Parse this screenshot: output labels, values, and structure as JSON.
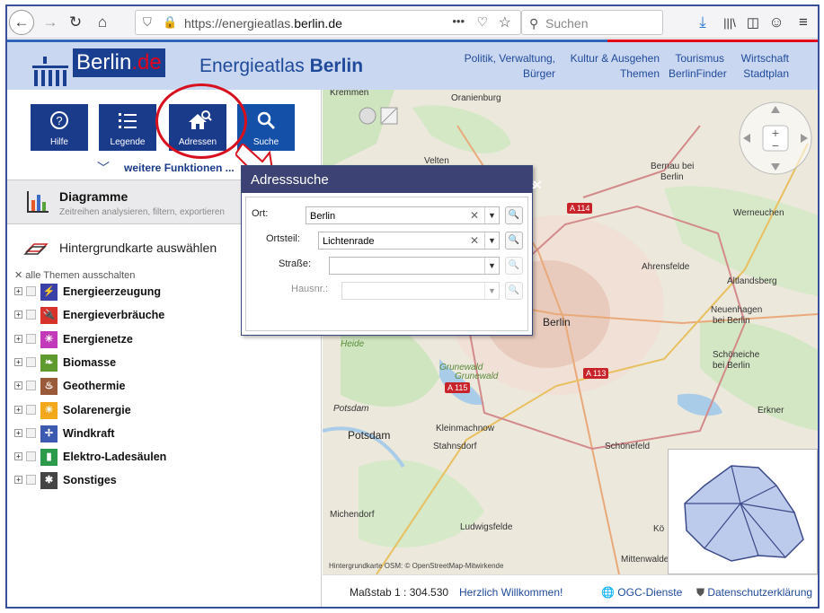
{
  "browser": {
    "url_prefix": "https://energieatlas.",
    "url_domain": "berlin.de",
    "search_placeholder": "Suchen",
    "more_icon": "•••"
  },
  "header": {
    "logo_text": "Berlin",
    "logo_suffix": ".de",
    "app_title_prefix": "Energieatlas ",
    "app_title_bold": "Berlin",
    "nav": [
      {
        "top": "Politik, Verwaltung, Bürger",
        "bottom": ""
      },
      {
        "top": "Kultur & Ausgehen",
        "bottom": "Themen"
      },
      {
        "top": "Tourismus",
        "bottom": "BerlinFinder"
      },
      {
        "top": "Wirtschaft",
        "bottom": "Stadtplan"
      }
    ]
  },
  "toolbar": {
    "buttons": [
      {
        "label": "Hilfe",
        "icon": "help-icon"
      },
      {
        "label": "Legende",
        "icon": "legend-list-icon"
      },
      {
        "label": "Adressen",
        "icon": "address-house-icon"
      },
      {
        "label": "Suche",
        "icon": "search-icon"
      }
    ],
    "more_label": "weitere Funktionen ..."
  },
  "diagramme": {
    "title": "Diagramme",
    "subtitle": "Zeitreihen analysieren, filtern, exportieren"
  },
  "background_map_label": "Hintergrundkarte auswählen",
  "all_off_label": "alle Themen ausschalten",
  "layers": [
    {
      "name": "Energieerzeugung",
      "color": "#3b3fa8",
      "icon": "⚡"
    },
    {
      "name": "Energieverbräuche",
      "color": "#d7332a",
      "icon": "🔌"
    },
    {
      "name": "Energienetze",
      "color": "#c23ab9",
      "icon": "✳"
    },
    {
      "name": "Biomasse",
      "color": "#5f9a2f",
      "icon": "❧"
    },
    {
      "name": "Geothermie",
      "color": "#9a5a3a",
      "icon": "♨"
    },
    {
      "name": "Solarenergie",
      "color": "#f3a81c",
      "icon": "☀"
    },
    {
      "name": "Windkraft",
      "color": "#3b5ab0",
      "icon": "✢"
    },
    {
      "name": "Elektro-Ladesäulen",
      "color": "#2b9a4a",
      "icon": "▮"
    },
    {
      "name": "Sonstiges",
      "color": "#444444",
      "icon": "✱"
    }
  ],
  "dialog": {
    "title": "Adresssuche",
    "fields": [
      {
        "label": "Ort:",
        "value": "Berlin"
      },
      {
        "label": "Ortsteil:",
        "value": "Lichtenrade"
      },
      {
        "label": "Straße:",
        "value": ""
      },
      {
        "label": "Hausnr.:",
        "value": ""
      }
    ]
  },
  "map_labels": [
    "Kremmen",
    "Oranienburg",
    "Velten",
    "Bernau bei",
    "Berlin",
    "A 114",
    "Werneuchen",
    "Ahrensfelde",
    "Altlandsberg",
    "Neuenhagen",
    "bei Berlin",
    "Berlin",
    "Heide",
    "Schöneiche",
    "bei Berlin",
    "Grunewald",
    "Grunewald",
    "A 113",
    "A 115",
    "Potsdam",
    "Erkner",
    "Potsdam",
    "Kleinmachnow",
    "Stahnsdorf",
    "Schönefeld",
    "Michendorf",
    "Ludwigsfelde",
    "Kö",
    "Mittenwalde"
  ],
  "map_copyright": "Hintergrundkarte OSM: © OpenStreetMap-Mitwirkende",
  "footer": {
    "scale": "Maßstab 1 : 304.530",
    "welcome": "Herzlich Willkommen!",
    "ogc": "OGC-Dienste",
    "privacy": "Datenschutzerklärung"
  }
}
